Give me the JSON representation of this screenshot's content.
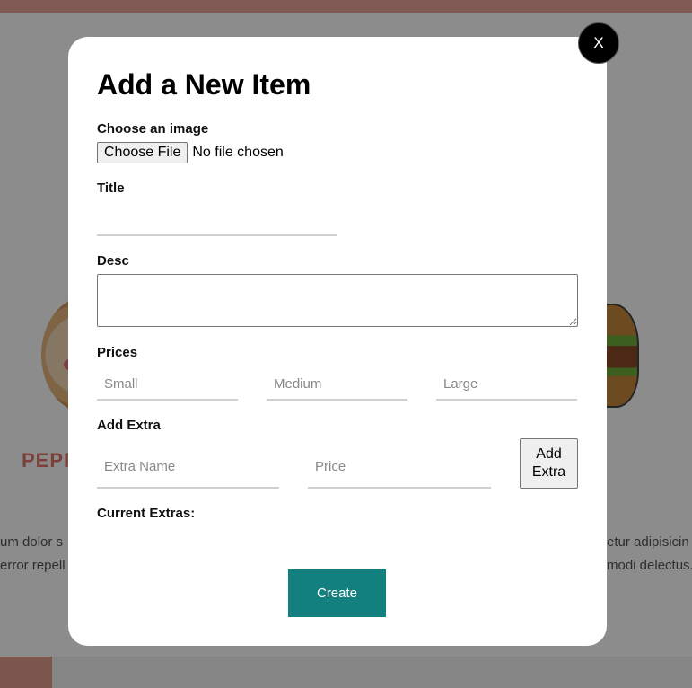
{
  "background": {
    "card_title": "PEPP",
    "text_left_1": "um dolor s",
    "text_left_2": "error repell",
    "text_right_1": "etur adipisicin",
    "text_right_2": "modi delectus."
  },
  "modal": {
    "close_label": "X",
    "title": "Add a New Item",
    "image": {
      "label": "Choose an image",
      "button_label": "Choose File",
      "status": "No file chosen"
    },
    "title_field": {
      "label": "Title",
      "value": ""
    },
    "desc_field": {
      "label": "Desc",
      "value": ""
    },
    "prices": {
      "label": "Prices",
      "small_placeholder": "Small",
      "medium_placeholder": "Medium",
      "large_placeholder": "Large"
    },
    "extra": {
      "label": "Add Extra",
      "name_placeholder": "Extra Name",
      "price_placeholder": "Price",
      "add_button_label": "Add Extra"
    },
    "current_extras_label": "Current Extras:",
    "create_label": "Create"
  },
  "colors": {
    "accent": "#12807f",
    "topbar": "#e8a59b",
    "overlay": "rgba(0,0,0,0.45)"
  }
}
